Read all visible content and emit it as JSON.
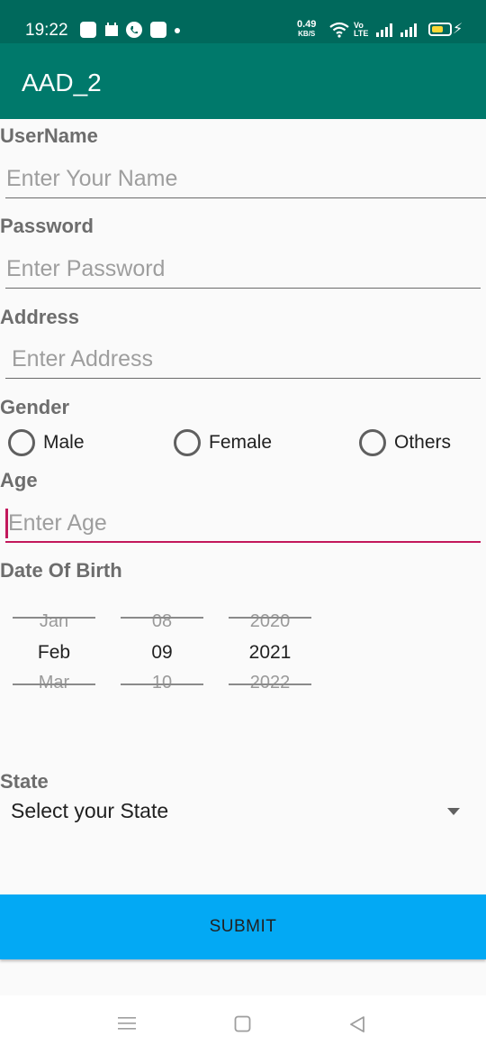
{
  "status_bar": {
    "time": "19:22",
    "net_speed_value": "0.49",
    "net_speed_unit": "KB/S",
    "volte_line1": "Vo",
    "volte_line2": "LTE",
    "icons": [
      "notification-app-icon",
      "calendar-icon",
      "phone-icon",
      "sim-app-icon",
      "dot-icon",
      "wifi-icon",
      "signal-icon",
      "battery-icon",
      "charging-icon"
    ]
  },
  "app_bar": {
    "title": "AAD_2",
    "color": "#00796b"
  },
  "form": {
    "username": {
      "label": "UserName",
      "placeholder": "Enter Your Name",
      "value": ""
    },
    "password": {
      "label": "Password",
      "placeholder": "Enter Password",
      "value": ""
    },
    "address": {
      "label": "Address",
      "placeholder": "Enter Address",
      "value": ""
    },
    "gender": {
      "label": "Gender",
      "options": [
        "Male",
        "Female",
        "Others"
      ],
      "selected": null
    },
    "age": {
      "label": "Age",
      "placeholder": "Enter Age",
      "value": "",
      "focused": true,
      "accent": "#c2185b"
    },
    "dob": {
      "label": "Date Of Birth",
      "month": {
        "prev": "Jan",
        "selected": "Feb",
        "next": "Mar"
      },
      "day": {
        "prev": "08",
        "selected": "09",
        "next": "10"
      },
      "year": {
        "prev": "2020",
        "selected": "2021",
        "next": "2022"
      }
    },
    "state": {
      "label": "State",
      "selected": "Select your State"
    }
  },
  "submit": {
    "label": "SUBMIT",
    "color": "#03a9f4"
  },
  "nav_bar": {
    "buttons": [
      "menu-icon",
      "home-square-icon",
      "back-triangle-icon"
    ]
  }
}
